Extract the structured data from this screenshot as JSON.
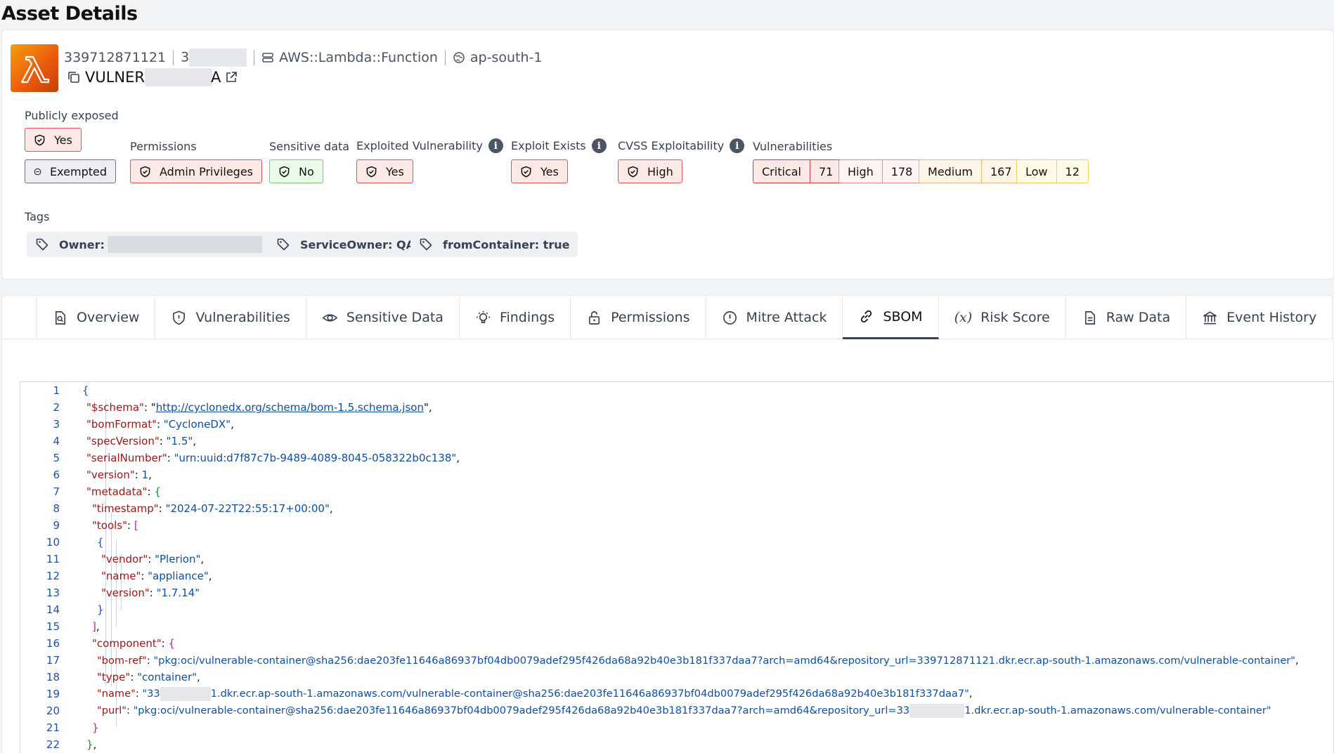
{
  "page": {
    "title": "Asset Details"
  },
  "asset": {
    "account_id": "339712871121",
    "account_name_prefix": "3",
    "resource_type": "AWS::Lambda::Function",
    "region": "ap-south-1",
    "name_prefix": "VULNER",
    "name_suffix": "A"
  },
  "attributes": {
    "publicly_exposed": {
      "label": "Publicly exposed",
      "value": "Yes",
      "exempt": "Exempted"
    },
    "permissions": {
      "label": "Permissions",
      "value": "Admin Privileges"
    },
    "sensitive_data": {
      "label": "Sensitive data",
      "value": "No"
    },
    "exploited_vulnerability": {
      "label": "Exploited Vulnerability",
      "value": "Yes"
    },
    "exploit_exists": {
      "label": "Exploit Exists",
      "value": "Yes"
    },
    "cvss_exploitability": {
      "label": "CVSS Exploitability",
      "value": "High"
    },
    "vulnerabilities": {
      "label": "Vulnerabilities",
      "critical": {
        "label": "Critical",
        "count": "71"
      },
      "high": {
        "label": "High",
        "count": "178"
      },
      "medium": {
        "label": "Medium",
        "count": "167"
      },
      "low": {
        "label": "Low",
        "count": "12"
      }
    }
  },
  "tags": {
    "label": "Tags",
    "items": [
      "Owner:",
      "ServiceOwner: QA",
      "fromContainer: true"
    ]
  },
  "tabs": [
    {
      "label": "Overview",
      "icon": "overview-icon"
    },
    {
      "label": "Vulnerabilities",
      "icon": "shield-icon"
    },
    {
      "label": "Sensitive Data",
      "icon": "eye-icon"
    },
    {
      "label": "Findings",
      "icon": "lightbulb-icon"
    },
    {
      "label": "Permissions",
      "icon": "lock-icon"
    },
    {
      "label": "Mitre Attack",
      "icon": "alert-circle-icon"
    },
    {
      "label": "SBOM",
      "icon": "link-icon",
      "active": true
    },
    {
      "label": "Risk Score",
      "icon": "function-icon"
    },
    {
      "label": "Raw Data",
      "icon": "document-icon"
    },
    {
      "label": "Event History",
      "icon": "bank-icon"
    }
  ],
  "sbom": {
    "line_numbers": [
      "1",
      "2",
      "3",
      "4",
      "5",
      "6",
      "7",
      "8",
      "9",
      "10",
      "11",
      "12",
      "13",
      "14",
      "15",
      "16",
      "17",
      "18",
      "19",
      "20",
      "21",
      "22"
    ],
    "schema_key": "\"$schema\"",
    "schema_url": "http://cyclonedx.org/schema/bom-1.5.schema.json",
    "bomFormat_key": "\"bomFormat\"",
    "bomFormat_value": "\"CycloneDX\"",
    "specVersion_key": "\"specVersion\"",
    "specVersion_value": "\"1.5\"",
    "serialNumber_key": "\"serialNumber\"",
    "serialNumber_value": "\"urn:uuid:d7f87c7b-9489-4089-8045-058322b0c138\"",
    "version_key": "\"version\"",
    "version_value": "1",
    "metadata_key": "\"metadata\"",
    "timestamp_key": "\"timestamp\"",
    "timestamp_value": "\"2024-07-22T22:55:17+00:00\"",
    "tools_key": "\"tools\"",
    "vendor_key": "\"vendor\"",
    "vendor_value": "\"Plerion\"",
    "tool_name_key": "\"name\"",
    "tool_name_value": "\"appliance\"",
    "tool_version_key": "\"version\"",
    "tool_version_value": "\"1.7.14\"",
    "component_key": "\"component\"",
    "bomref_key": "\"bom-ref\"",
    "bomref_value": "\"pkg:oci/vulnerable-container@sha256:dae203fe11646a86937bf04db0079adef295f426da68a92b40e3b181f337daa7?arch=amd64&repository_url=339712871121.dkr.ecr.ap-south-1.amazonaws.com/vulnerable-container\"",
    "type_key": "\"type\"",
    "type_value": "\"container\"",
    "comp_name_key": "\"name\"",
    "comp_name_prefix": "\"33",
    "comp_name_suffix": "1.dkr.ecr.ap-south-1.amazonaws.com/vulnerable-container@sha256:dae203fe11646a86937bf04db0079adef295f426da68a92b40e3b181f337daa7\"",
    "purl_key": "\"purl\"",
    "purl_prefix": "\"pkg:oci/vulnerable-container@sha256:dae203fe11646a86937bf04db0079adef295f426da68a92b40e3b181f337daa7?arch=amd64&repository_url=33",
    "purl_suffix": "1.dkr.ecr.ap-south-1.amazonaws.com/vulnerable-container\""
  }
}
